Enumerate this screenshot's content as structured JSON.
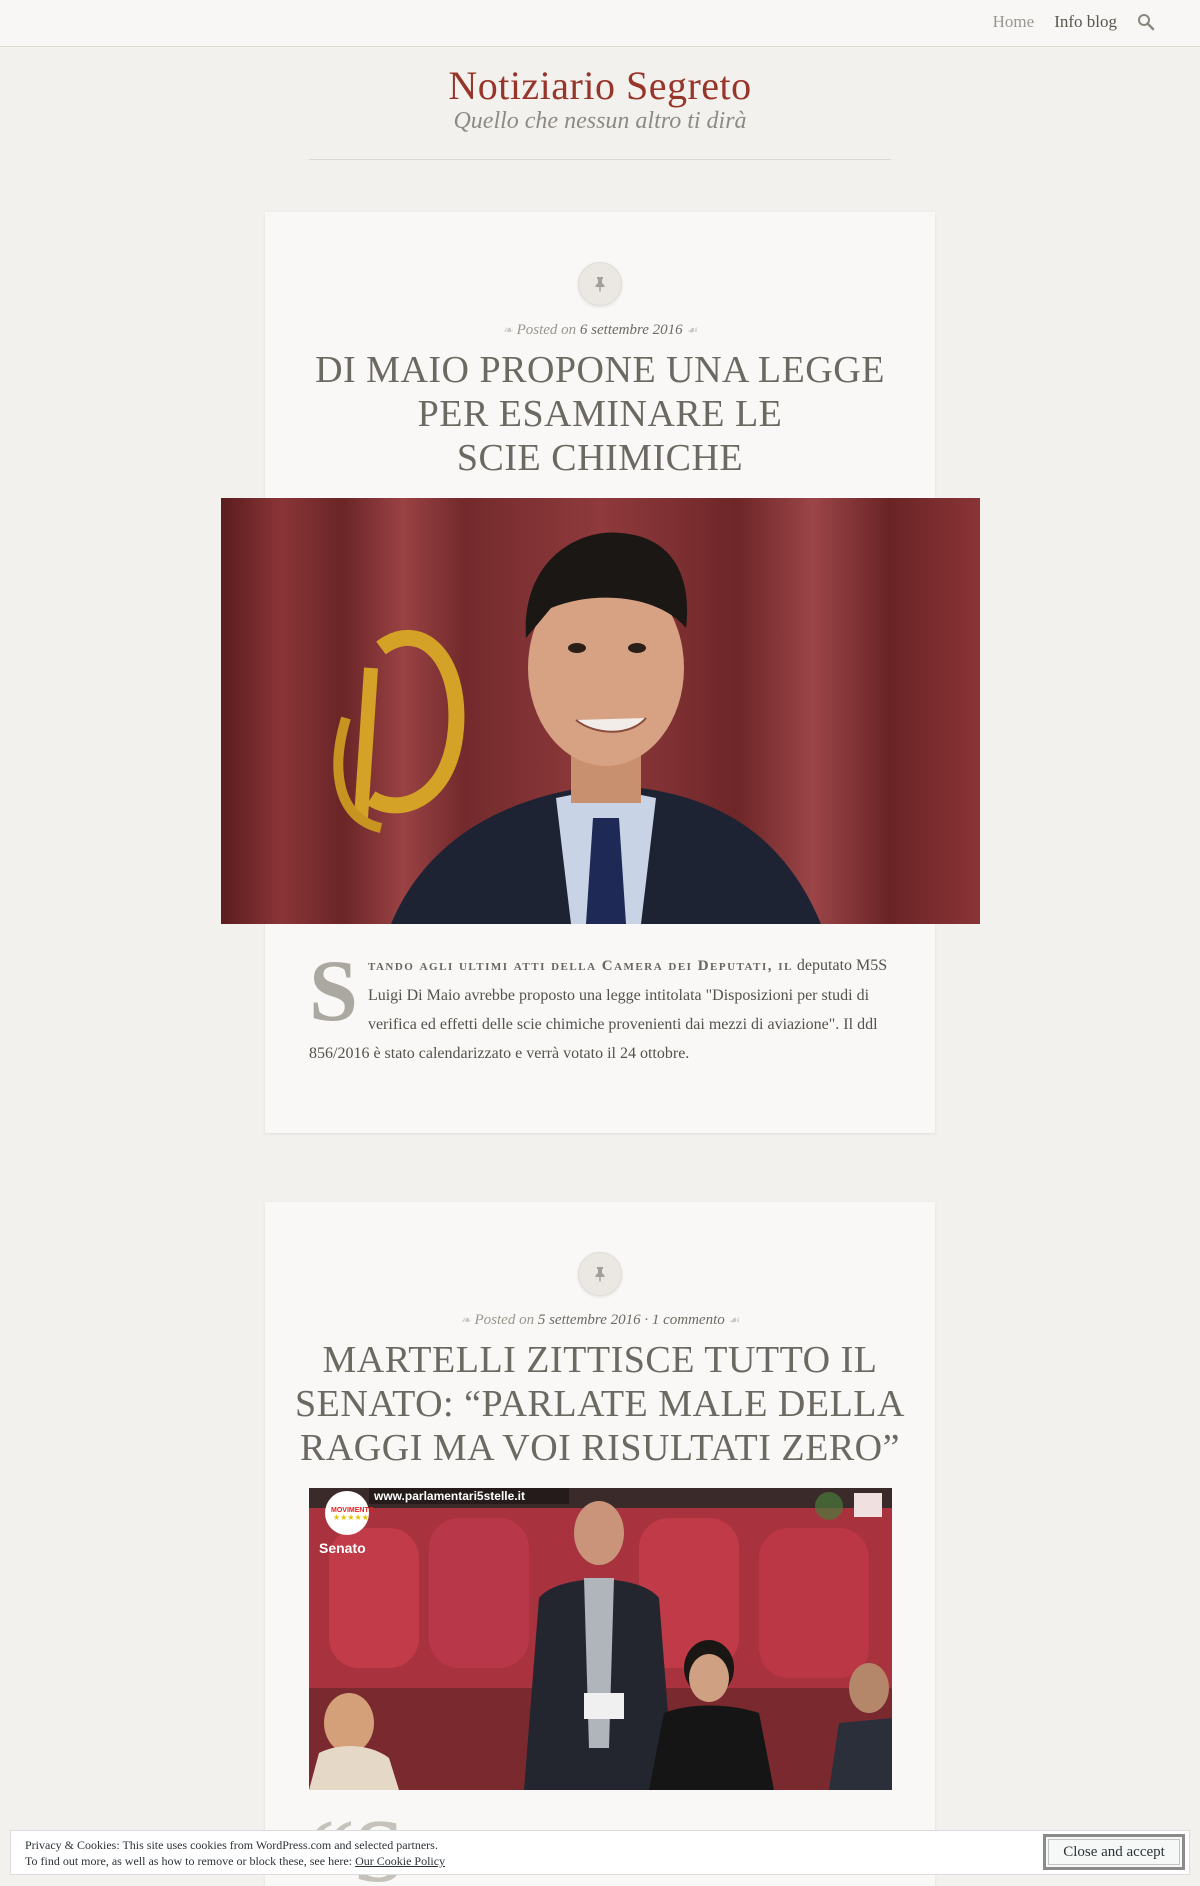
{
  "nav": {
    "home": "Home",
    "info": "Info blog"
  },
  "site": {
    "title": "Notiziario Segreto",
    "description": "Quello che nessun altro ti dirà"
  },
  "posts": [
    {
      "meta_prefix": "Posted on",
      "date": "6 settembre 2016",
      "title_lines": [
        "DI MAIO PROPONE UNA LEGGE",
        "PER ESAMINARE LE",
        "SCIE CHIMICHE"
      ],
      "dropcap": "S",
      "lead_smallcaps": "tando agli ultimi atti della Camera dei Deputati, il",
      "body": "deputato M5S Luigi Di Maio avrebbe proposto una legge intitolata \"Disposizioni per studi di verifica ed effetti delle scie chimiche provenienti dai mezzi di aviazione\". Il ddl 856/2016 è stato calendarizzato e verrà votato il 24 ottobre."
    },
    {
      "meta_prefix": "Posted on",
      "date": "5 settembre 2016",
      "comments": "1 commento",
      "title_lines": [
        "MARTELLI ZITTISCE TUTTO IL",
        "SENATO: “PARLATE MALE DELLA",
        "RAGGI MA VOI RISULTATI ZERO”"
      ],
      "image_overlay": {
        "site": "www.parlamentari5stelle.it",
        "badge_top": "MOVIMENTO",
        "badge_bottom": "Senato"
      }
    }
  ],
  "cookie": {
    "line1": "Privacy & Cookies: This site uses cookies from WordPress.com and selected partners.",
    "line2": "To find out more, as well as how to remove or block these, see here:",
    "link": "Our Cookie Policy",
    "button": "Close and accept"
  }
}
